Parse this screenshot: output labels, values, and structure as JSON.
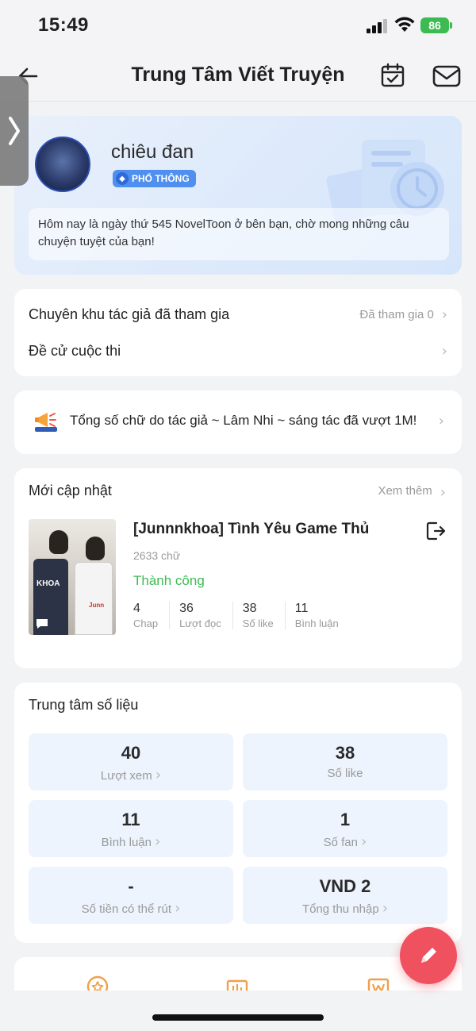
{
  "status_bar": {
    "time": "15:49",
    "battery": "86"
  },
  "nav": {
    "title": "Trung Tâm Viết Truyện"
  },
  "profile": {
    "name": "chiêu đan",
    "rank": "PHỔ THÔNG",
    "welcome": "Hôm nay là ngày thứ 545 NovelToon ở bên bạn, chờ mong những câu chuyện tuyệt của bạn!"
  },
  "menu": {
    "zone_label": "Chuyên khu tác giả đã tham gia",
    "zone_status": "Đã tham gia 0",
    "contest_label": "Đề cử cuộc thi"
  },
  "announcement": {
    "text": "Tổng số chữ do tác giả ~ Lâm Nhi ~ sáng tác đã vượt 1M!"
  },
  "recent": {
    "section_title": "Mới cập nhật",
    "see_more": "Xem thêm",
    "story": {
      "title": "[Junnnkhoa] Tình Yêu Game Thủ",
      "word_count": "2633 chữ",
      "status": "Thành công",
      "cover_jersey_text": "KHOA",
      "cover_jersey_text_2": "Junn",
      "stats": [
        {
          "value": "4",
          "label": "Chap"
        },
        {
          "value": "36",
          "label": "Lượt đọc"
        },
        {
          "value": "38",
          "label": "Số like"
        },
        {
          "value": "11",
          "label": "Bình luận"
        }
      ]
    }
  },
  "data_center": {
    "section_title": "Trung tâm số liệu",
    "metrics": [
      {
        "value": "40",
        "label": "Lượt xem"
      },
      {
        "value": "38",
        "label": "Số like"
      },
      {
        "value": "11",
        "label": "Bình luận"
      },
      {
        "value": "1",
        "label": "Số fan"
      },
      {
        "value": "-",
        "label": "Số tiền có thể rút"
      },
      {
        "value": "VND 2",
        "label": "Tổng thu nhập"
      }
    ]
  },
  "colors": {
    "accent": "#f0515f",
    "success": "#3dbb53",
    "badge": "#4e8ff0",
    "icon_orange": "#f0a04b"
  }
}
